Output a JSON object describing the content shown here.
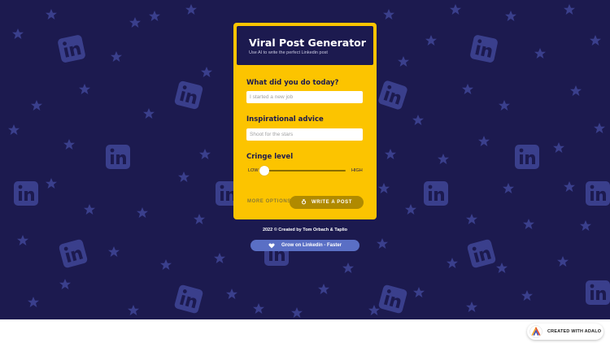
{
  "header": {
    "title": "Viral Post Generator  ",
    "subtitle": "Use AI to write the perfect Linkedin post"
  },
  "form": {
    "fields": [
      {
        "label": "What did you do today?",
        "placeholder": "I started a new job"
      },
      {
        "label": "Inspirational advice",
        "placeholder": "Shoot for the stars"
      }
    ],
    "cringe": {
      "label": "Cringe level",
      "low_label": "LOW",
      "high_label": "HIGH",
      "level": 0
    },
    "more_options_label": "MORE OPTIONS",
    "write_button_label": "WRITE A POST"
  },
  "footer": {
    "credit": "2022 © Created by  Tom Orbach  & Taplio",
    "grow_button_label": "Grow on Linkedin - Faster"
  },
  "badge": {
    "label": "CREATED WITH ADALO"
  },
  "colors": {
    "background": "#1c1a4f",
    "card": "#fcc400",
    "pattern": "#3a3f8c",
    "button": "#b08a00",
    "grow_button": "#5a6fc5"
  },
  "icons": {
    "pattern": [
      "star-icon",
      "linkedin-icon"
    ],
    "write_button": "pen-icon",
    "grow_button": "heart-icon",
    "badge": "adalo-logo-icon"
  }
}
